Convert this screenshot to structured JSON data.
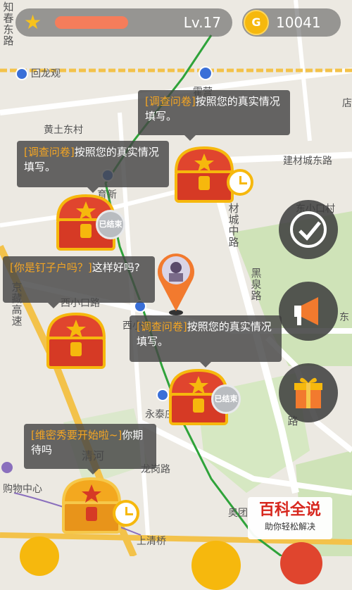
{
  "hud": {
    "level": "Lv.17",
    "coins": "10041",
    "coin_symbol": "G",
    "star_icon": "star-icon"
  },
  "map": {
    "labels": {
      "huilongguan": "回龙观",
      "huoying": "霍营",
      "huangtu_dongcun": "黄土东村",
      "yuxin": "育新",
      "jiancai_chenglu": "建材城东路",
      "dongshangcun": "东小口村",
      "xixiaokoulu": "西小口路",
      "xixiaokou": "西小口",
      "yongtai": "永泰庄",
      "qinghe": "清河",
      "longgang_lu": "龙岗路",
      "gouwu_zhongxin": "购物中心",
      "shangqingqiao": "上清桥",
      "aoti": "奥团",
      "dian": "店",
      "dong": "东",
      "v_zhichun": "知春东路",
      "v_jiancai": "材城中路",
      "v_heiquan": "黑泉路",
      "v_jingzang": "京藏高速",
      "v_lu": "路"
    }
  },
  "bubbles": [
    {
      "tag": "[调查问卷]",
      "text": "按照您的真实情况填写。"
    },
    {
      "tag": "[调查问卷]",
      "text": "按照您的真实情况填写。"
    },
    {
      "tag": "[你是钉子户吗？]",
      "text": "这样好吗?"
    },
    {
      "tag": "[调查问卷]",
      "text": "按照您的真实情况填写。"
    },
    {
      "tag": "[维密秀要开始啦~]",
      "text": "你期待吗"
    }
  ],
  "stamps": {
    "done_label": "已结束"
  },
  "side_buttons": [
    "check-icon",
    "megaphone-icon",
    "gift-icon"
  ],
  "watermark": {
    "title": "百科全说",
    "subtitle": "助你轻松解决"
  },
  "colors": {
    "accent_orange": "#f5a623",
    "coin_gold": "#f6b80d",
    "subway_green": "#2fa33a",
    "road_yellow": "#f3c24a"
  }
}
